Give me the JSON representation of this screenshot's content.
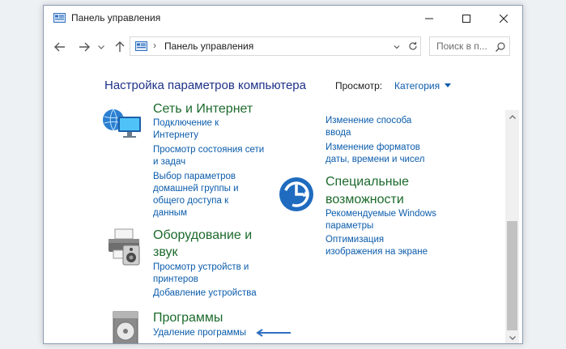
{
  "window": {
    "title": "Панель управления"
  },
  "navbar": {
    "address": "Панель управления",
    "separator": "›",
    "search_placeholder": "Поиск в п..."
  },
  "content": {
    "heading": "Настройка параметров компьютера",
    "view_label": "Просмотр:",
    "view_value": "Категория",
    "categories": {
      "network": {
        "title": "Сеть и Интернет",
        "links": [
          "Подключение к",
          "Интернету",
          "Просмотр состояния сети",
          "и задач",
          "Выбор параметров",
          "домашней группы и",
          "общего доступа к",
          "данным"
        ]
      },
      "hardware": {
        "title_line1": "Оборудование и",
        "title_line2": "звук",
        "links": [
          "Просмотр устройств и",
          "принтеров",
          "Добавление устройства"
        ]
      },
      "programs": {
        "title": "Программы",
        "links": [
          "Удаление программы"
        ]
      },
      "appearance": {
        "links": [
          "Изменение способа",
          "ввода",
          "Изменение форматов",
          "даты, времени и чисел"
        ]
      },
      "accessibility": {
        "title_line1": "Специальные",
        "title_line2": "возможности",
        "links": [
          "Рекомендуемые Windows",
          "параметры",
          "Оптимизация",
          "изображения на экране"
        ]
      }
    }
  },
  "colors": {
    "link": "#0b5cab",
    "category_title": "#1c6a2c",
    "heading": "#1e3287",
    "annotation_arrow": "#2f6fc0"
  },
  "icons": {
    "title": "control-panel-icon",
    "back": "arrow-left-icon",
    "forward": "arrow-right-icon",
    "up": "arrow-up-icon",
    "refresh": "refresh-icon",
    "search": "search-icon",
    "network": "network-icon",
    "hardware": "printer-icon",
    "programs": "programs-icon",
    "accessibility": "accessibility-icon"
  }
}
